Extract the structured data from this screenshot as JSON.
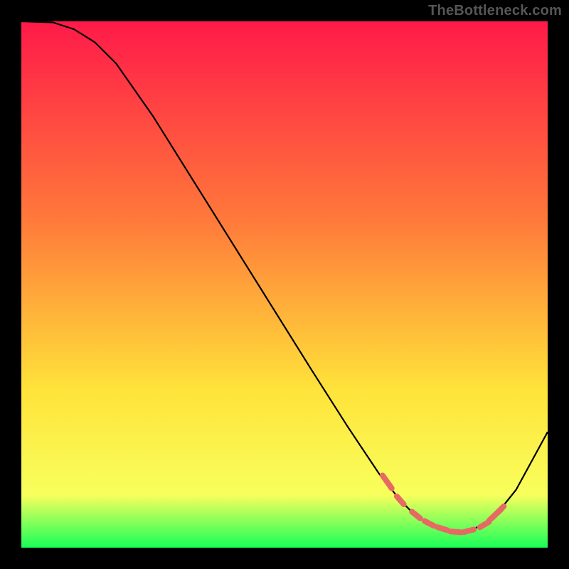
{
  "attribution": "TheBottleneck.com",
  "colors": {
    "grad_top": "#ff1a49",
    "grad_mid1": "#ff7a3a",
    "grad_mid2": "#ffe33a",
    "grad_mid3": "#f8ff5c",
    "grad_bottom": "#18ff58",
    "curve": "#000000",
    "marker": "#e66a63"
  },
  "chart_data": {
    "type": "line",
    "title": "",
    "xlabel": "",
    "ylabel": "",
    "xlim": [
      0,
      100
    ],
    "ylim": [
      0,
      100
    ],
    "curve": {
      "x": [
        0,
        6,
        10,
        14,
        18,
        25,
        35,
        45,
        55,
        62,
        68,
        72,
        75,
        78,
        82,
        86,
        90,
        94,
        100
      ],
      "y": [
        100,
        99.8,
        98.5,
        96,
        92,
        82,
        66,
        50,
        34,
        23,
        14,
        9,
        6,
        4,
        3,
        3.5,
        6,
        11,
        22
      ]
    },
    "markers": {
      "x": [
        69.5,
        72,
        75,
        77.5,
        80,
        82.5,
        85,
        88,
        90,
        90.6
      ],
      "y": [
        12.5,
        9.0,
        6.2,
        4.6,
        3.6,
        3.0,
        3.2,
        4.4,
        6.2,
        6.8
      ],
      "len": [
        3.0,
        2.0,
        2.0,
        2.0,
        2.0,
        2.0,
        2.0,
        2.0,
        3.0,
        3.0
      ]
    }
  }
}
